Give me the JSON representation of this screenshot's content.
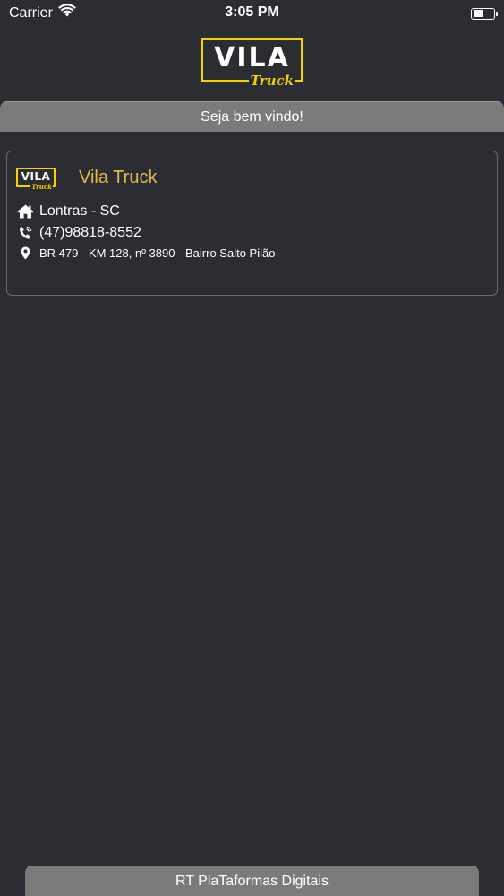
{
  "status_bar": {
    "carrier": "Carrier",
    "time": "3:05 PM",
    "icons": [
      "wifi-icon",
      "battery-icon"
    ]
  },
  "header": {
    "logo_main": "VILA",
    "logo_script": "Truck"
  },
  "welcome_text": "Seja bem vindo!",
  "card": {
    "logo_main": "VILA",
    "logo_script": "Truck",
    "title": "Vila Truck",
    "city": "Lontras - SC",
    "phone": "(47)98818-8552",
    "address": "BR 479 - KM 128, nº 3890 - Bairro Salto Pilão",
    "icons": [
      "home-icon",
      "phone-icon",
      "location-pin-icon"
    ]
  },
  "footer_text": "RT PlaTaformas Digitais",
  "colors": {
    "background": "#2c2d32",
    "accent_yellow": "#f5d100",
    "title_gold": "#e5b84c",
    "bar_gray": "#7b7b7b"
  }
}
